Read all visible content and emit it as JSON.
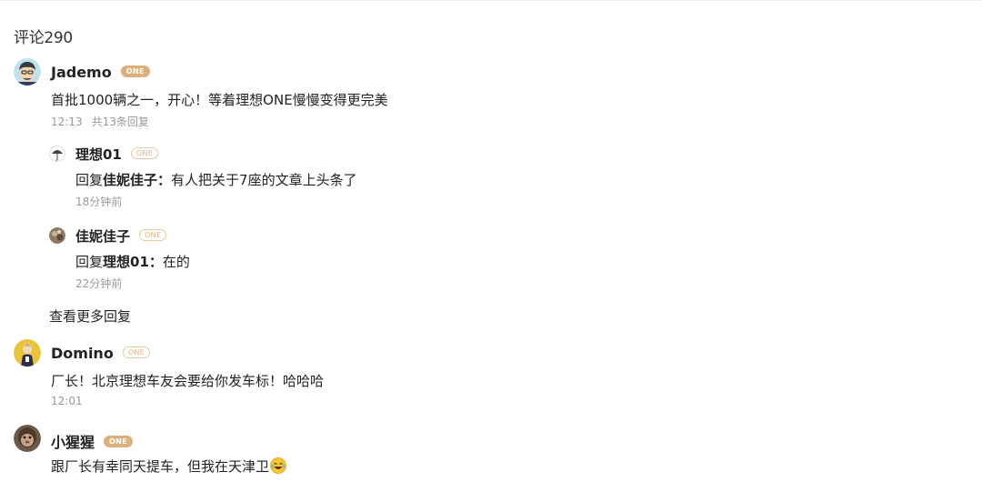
{
  "comments_header": "评论290",
  "comments": [
    {
      "user": "Jademo",
      "badge": "ONE",
      "text": "首批1000辆之一，开心！等着理想ONE慢慢变得更完美",
      "time": "12:13",
      "reply_count": "共13条回复",
      "avatar_icon": "cartoon-man-avatar",
      "replies": [
        {
          "user": "理想01",
          "badge": "ONE",
          "reply_prefix": "回复",
          "reply_to": "佳妮佳子：",
          "text": "有人把关于7座的文章上头条了",
          "time": "18分钟前",
          "avatar_icon": "umbrella-avatar"
        },
        {
          "user": "佳妮佳子",
          "badge": "ONE",
          "reply_prefix": "回复",
          "reply_to": "理想01：",
          "text": "在的",
          "time": "22分钟前",
          "avatar_icon": "photo-avatar"
        }
      ],
      "more_replies": "查看更多回复"
    },
    {
      "user": "Domino",
      "badge": "ONE",
      "text": "厂长！北京理想车友会要给你发车标！哈哈哈",
      "time": "12:01",
      "avatar_icon": "cartoon-figure-avatar"
    },
    {
      "user": "小猩猩",
      "badge": "ONE",
      "text": "跟厂长有幸同天提车，但我在天津卫",
      "emoji": "joy-tears-emoji",
      "avatar_icon": "monkey-avatar"
    }
  ],
  "colors": {
    "badge_gold": "#dcb07a",
    "meta_gray": "#999999",
    "text": "#222222"
  }
}
